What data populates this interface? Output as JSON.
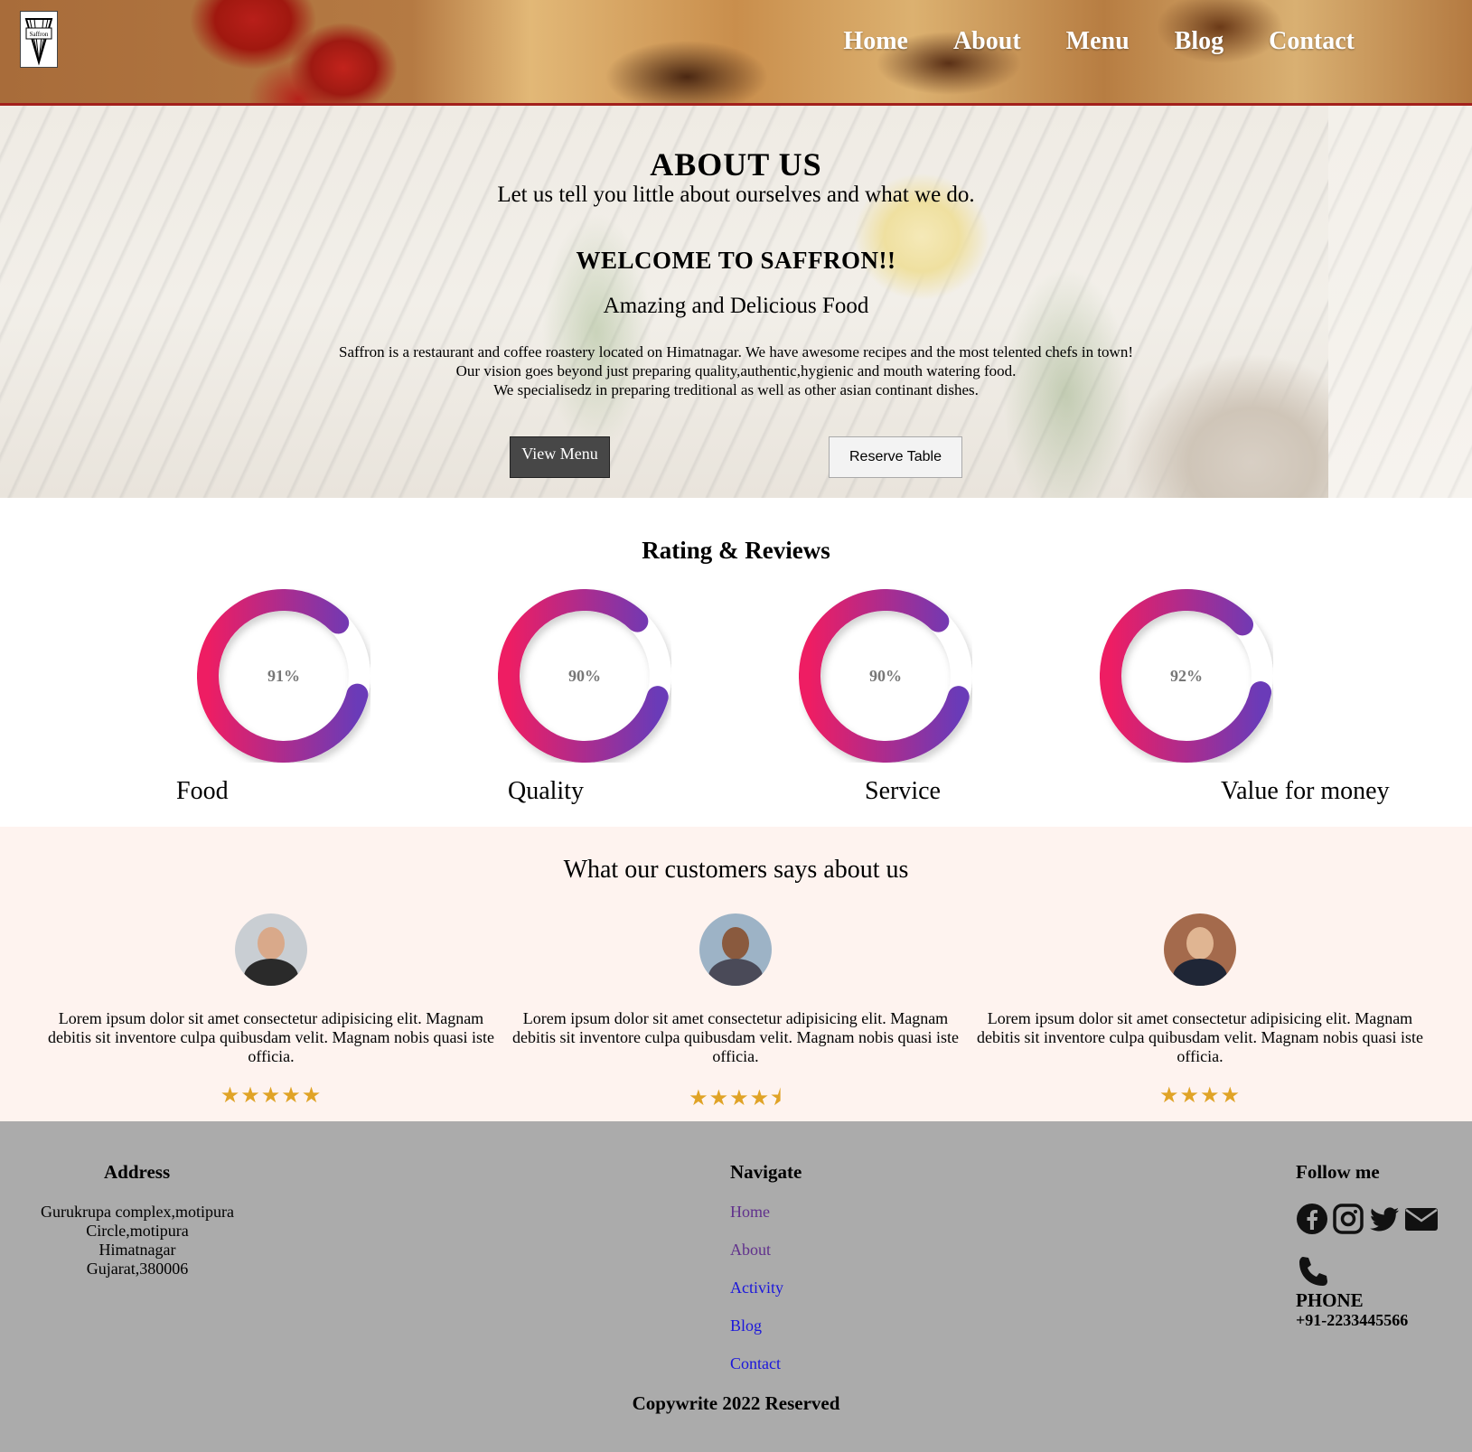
{
  "header": {
    "logo_icon": "saffron-logo-icon",
    "logo_text": "Saffron",
    "nav": [
      "Home",
      "About",
      "Menu",
      "Blog",
      "Contact"
    ]
  },
  "about": {
    "title": "ABOUT US",
    "tagline": "Let us tell you little about ourselves and what we do.",
    "welcome": "WELCOME TO SAFFRON!!",
    "subtitle": "Amazing and Delicious Food",
    "para_lines": [
      "Saffron is a restaurant and coffee roastery located on Himatnagar. We have awesome recipes and the most telented chefs in town!",
      "Our vision goes beyond just preparing quality,authentic,hygienic and mouth watering food.",
      "We specialisedz in preparing treditional as well as other asian continant dishes."
    ],
    "view_menu": "View Menu",
    "reserve_table": "Reserve Table"
  },
  "ratings": {
    "title": "Rating & Reviews",
    "items": [
      {
        "label": "Food",
        "value": 91,
        "text": "91%"
      },
      {
        "label": "Quality",
        "value": 90,
        "text": "90%"
      },
      {
        "label": "Service",
        "value": 90,
        "text": "90%"
      },
      {
        "label": "Value for money",
        "value": 92,
        "text": "92%"
      }
    ],
    "gradient": [
      "#ee1d63",
      "#6a3bb8"
    ]
  },
  "testimonials": {
    "title": "What our customers says about us",
    "items": [
      {
        "text": "Lorem ipsum dolor sit amet consectetur adipisicing elit. Magnam debitis sit inventore culpa quibusdam velit. Magnam nobis quasi iste officia.",
        "rating": 5,
        "stars": "★★★★★"
      },
      {
        "text": "Lorem ipsum dolor sit amet consectetur adipisicing elit. Magnam debitis sit inventore culpa quibusdam velit. Magnam nobis quasi iste officia.",
        "rating": 4.5,
        "stars": "★★★★⯨"
      },
      {
        "text": "Lorem ipsum dolor sit amet consectetur adipisicing elit. Magnam debitis sit inventore culpa quibusdam velit. Magnam nobis quasi iste officia.",
        "rating": 4,
        "stars": "★★★★"
      }
    ],
    "star_color": "#e0a326"
  },
  "footer": {
    "address_title": "Address",
    "address_lines": [
      "Gurukrupa complex,motipura",
      "Circle,motipura",
      "Himatnagar",
      "Gujarat,380006"
    ],
    "navigate_title": "Navigate",
    "nav_links": [
      "Home",
      "About",
      "Activity",
      "Blog",
      "Contact"
    ],
    "follow_title": "Follow me",
    "social_icons": [
      "facebook-icon",
      "instagram-icon",
      "twitter-icon",
      "email-icon"
    ],
    "phone_label": "PHONE",
    "phone_number": "+91-2233445566",
    "copyright": "Copywrite 2022 Reserved"
  }
}
